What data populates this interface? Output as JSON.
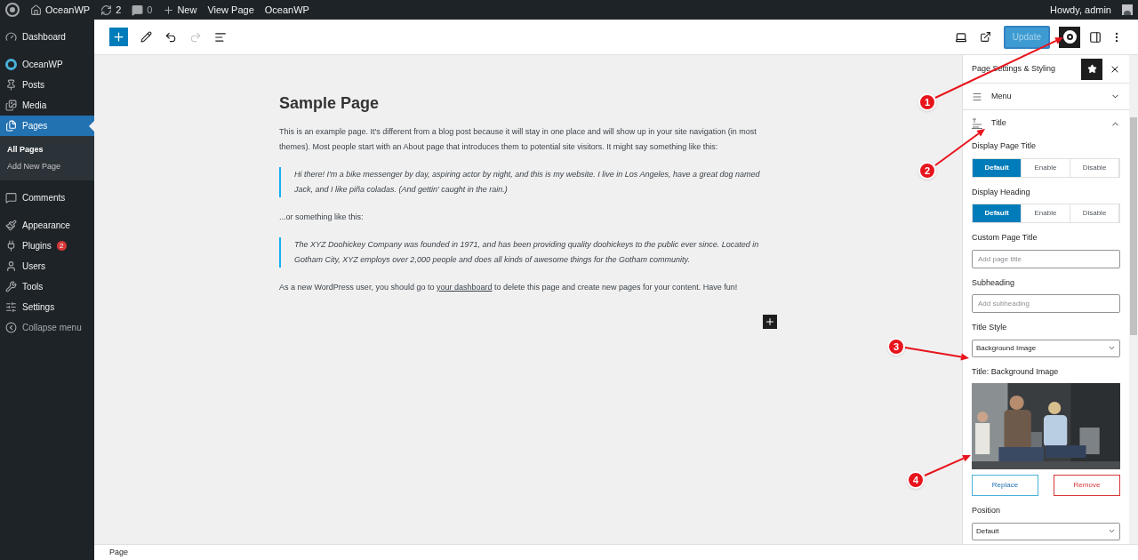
{
  "admin_bar": {
    "site": "OceanWP",
    "updates": "2",
    "comments": "0",
    "new": "New",
    "view": "View Page",
    "theme": "OceanWP",
    "greeting": "Howdy, admin"
  },
  "sidebar": {
    "items": [
      {
        "label": "Dashboard",
        "selected": false
      },
      {
        "label": "OceanWP",
        "selected": false
      },
      {
        "label": "Posts",
        "selected": false
      },
      {
        "label": "Media",
        "selected": false
      },
      {
        "label": "Pages",
        "selected": true,
        "children": [
          {
            "label": "All Pages",
            "selected": true
          },
          {
            "label": "Add New Page",
            "selected": false
          }
        ]
      },
      {
        "label": "Comments",
        "selected": false
      },
      {
        "label": "Appearance",
        "selected": false
      },
      {
        "label": "Plugins",
        "selected": false,
        "badge": "2"
      },
      {
        "label": "Users",
        "selected": false
      },
      {
        "label": "Tools",
        "selected": false
      },
      {
        "label": "Settings",
        "selected": false
      },
      {
        "label": "Collapse menu",
        "selected": false
      }
    ]
  },
  "toolbar": {
    "redo_disabled": true,
    "update": "Update",
    "update_disabled": true,
    "oceanwp_selected": true
  },
  "content": {
    "title": "Sample Page",
    "blocks": [
      {
        "kind": "paragraph",
        "text": "This is an example page. It's different from a blog post because it will stay in one place and will show up in your site navigation (in most themes). Most people start with an About page that introduces them to potential site visitors. It might say something like this:"
      },
      {
        "kind": "quote",
        "text": "Hi there! I'm a bike messenger by day, aspiring actor by night, and this is my website. I live in Los Angeles, have a great dog named Jack, and I like piña coladas. (And gettin' caught in the rain.)"
      },
      {
        "kind": "paragraph",
        "text": "...or something like this:"
      },
      {
        "kind": "quote",
        "text": "The XYZ Doohickey Company was founded in 1971, and has been providing quality doohickeys to the public ever since. Located in Gotham City, XYZ employs over 2,000 people and does all kinds of awesome things for the Gotham community."
      },
      {
        "kind": "link_paragraph",
        "before": "As a new WordPress user, you should go to ",
        "link": "your dashboard",
        "after": " to delete this page and create new pages for your content. Have fun!"
      }
    ]
  },
  "panel": {
    "title": "Page Settings & Styling",
    "pinned": true,
    "sections": [
      {
        "label": "Menu",
        "expanded": false
      },
      {
        "label": "Title",
        "expanded": true
      }
    ],
    "fields": [
      {
        "kind": "segmented",
        "label": "Display Page Title",
        "options": [
          {
            "label": "Default",
            "selected": true
          },
          {
            "label": "Enable",
            "selected": false
          },
          {
            "label": "Disable",
            "selected": false
          }
        ]
      },
      {
        "kind": "segmented",
        "label": "Display Heading",
        "options": [
          {
            "label": "Default",
            "selected": true
          },
          {
            "label": "Enable",
            "selected": false
          },
          {
            "label": "Disable",
            "selected": false
          }
        ]
      },
      {
        "kind": "input",
        "label": "Custom Page Title",
        "placeholder": "Add page title"
      },
      {
        "kind": "input",
        "label": "Subheading",
        "placeholder": "Add subheading"
      },
      {
        "kind": "select",
        "label": "Title Style",
        "value": "Background Image"
      },
      {
        "label": "Title: Background Image",
        "replace": "Replace",
        "remove": "Remove"
      },
      {
        "kind": "select",
        "label": "Position",
        "value": "Default"
      }
    ]
  },
  "status_bar": {
    "breadcrumb": "Page"
  },
  "annotations": [
    {
      "number": "1"
    },
    {
      "number": "2"
    },
    {
      "number": "3"
    },
    {
      "number": "4"
    }
  ]
}
